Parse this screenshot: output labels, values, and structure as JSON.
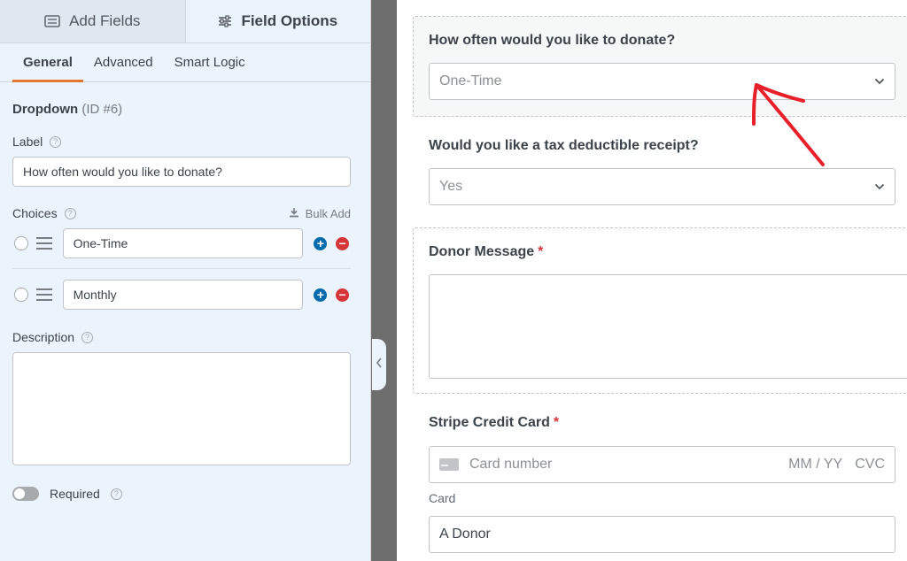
{
  "sidebar": {
    "tabs": {
      "add_fields": "Add Fields",
      "field_options": "Field Options"
    },
    "subtabs": [
      "General",
      "Advanced",
      "Smart Logic"
    ],
    "field_type": "Dropdown",
    "field_id": "(ID #6)",
    "label_heading": "Label",
    "label_value": "How often would you like to donate?",
    "choices_heading": "Choices",
    "bulk_add": "Bulk Add",
    "choices": [
      "One-Time",
      "Monthly"
    ],
    "description_heading": "Description",
    "description_value": "",
    "required_label": "Required",
    "required_on": false,
    "help_glyph": "?"
  },
  "preview": {
    "q1": {
      "label": "How often would you like to donate?",
      "value": "One-Time"
    },
    "q2": {
      "label": "Would you like a tax deductible receipt?",
      "value": "Yes"
    },
    "q3": {
      "label": "Donor Message",
      "required": "*"
    },
    "q4": {
      "label": "Stripe Credit Card",
      "required": "*",
      "card_placeholder": "Card number",
      "expiry_placeholder": "MM / YY",
      "cvc_placeholder": "CVC",
      "card_sublabel": "Card",
      "name_value": "A Donor"
    }
  },
  "colors": {
    "accent": "#e27730",
    "annotation": "#e8202a",
    "add": "#036aab",
    "remove": "#d63638"
  }
}
